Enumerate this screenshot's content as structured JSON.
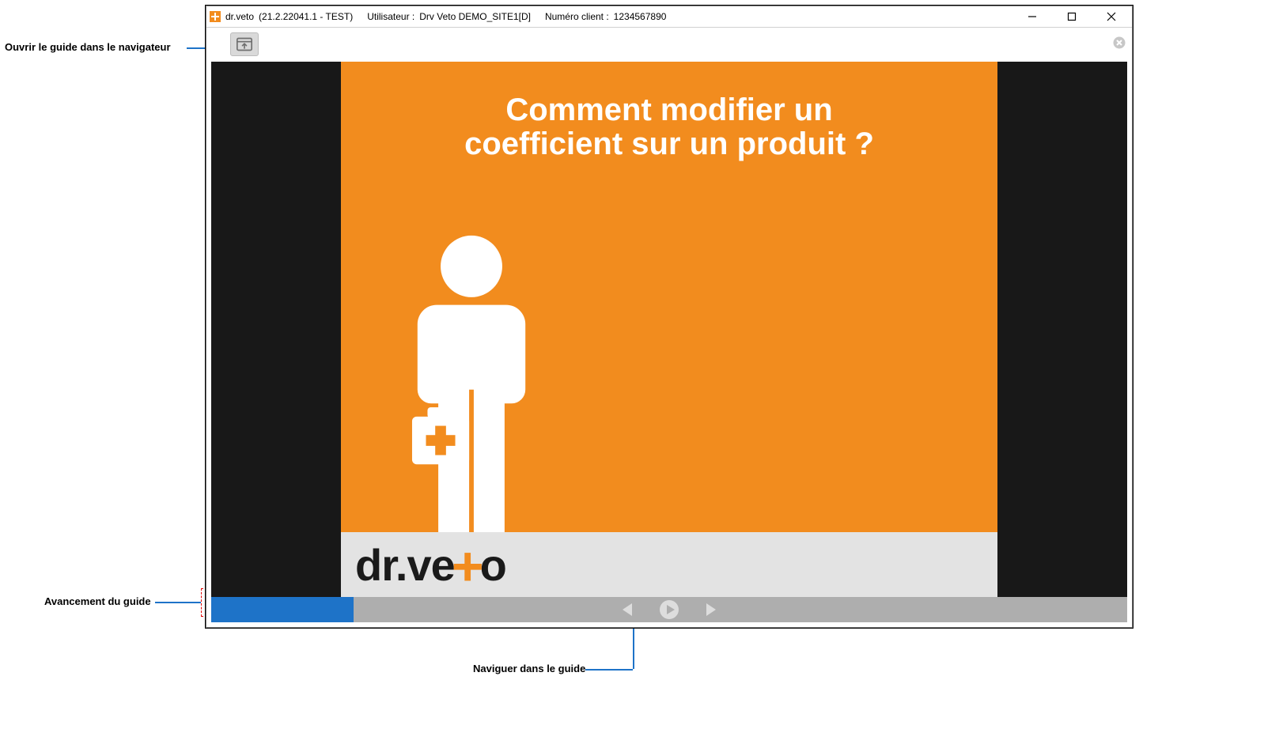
{
  "window": {
    "app_name": "dr.veto",
    "version": "(21.2.22041.1 - TEST)",
    "user_label": "Utilisateur :",
    "user_value": "Drv Veto  DEMO_SITE1[D]",
    "client_label": "Numéro client :",
    "client_value": "1234567890"
  },
  "toolbar": {
    "open_in_browser_tooltip": "Ouvrir le guide dans le navigateur"
  },
  "slide": {
    "title_line1": "Comment modifier un",
    "title_line2": "coefficient sur un produit ?",
    "brand_prefix": "dr.ve",
    "brand_suffix": "o"
  },
  "annotations": {
    "open_browser": "Ouvrir le guide dans le navigateur",
    "progress": "Avancement du guide",
    "navigate": "Naviguer dans le guide"
  },
  "colors": {
    "accent_orange": "#f28c1e",
    "leader_blue": "#1e73c8",
    "dashed_red": "#e20000"
  }
}
